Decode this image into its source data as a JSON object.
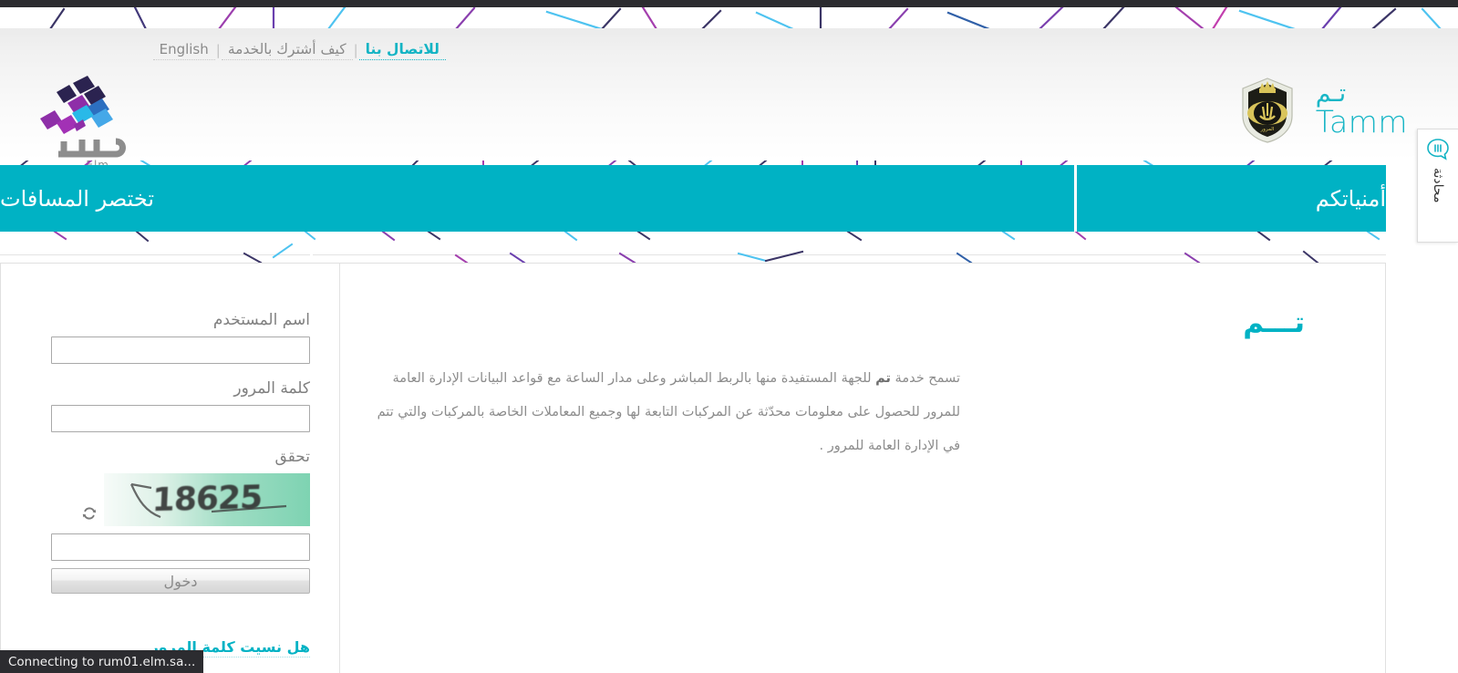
{
  "topnav": {
    "links": [
      {
        "label": "للاتصال بنا",
        "active": true
      },
      {
        "label": "كيف أشترك بالخدمة",
        "active": false
      },
      {
        "label": "English",
        "active": false
      }
    ],
    "separator": "|"
  },
  "logos": {
    "elm": {
      "name": "Elm",
      "latin_label": "Elm"
    },
    "tamm": {
      "arabic": "تـم",
      "latin": "Tamm",
      "emblem": "saudi-traffic-police-emblem"
    }
  },
  "banner": {
    "slogan_right": "تختصر المسافات",
    "slogan_left": "أمنياتكم",
    "background_color": "#00b2c4"
  },
  "chat_tab": {
    "label": "محادثة",
    "icon": "chat-bubble-icon"
  },
  "intro": {
    "title": "تـــم",
    "lead_word": "تم",
    "body_before": "تسمح خدمة ",
    "body_after": " للجهة المستفيدة منها بالربط المباشر وعلى مدار الساعة مع قواعد البيانات الإدارة العامة للمرور للحصول على معلومات محدّثة عن المركبات التابعة لها وجميع المعاملات الخاصة بالمركبات والتي تتم في الإدارة العامة للمرور ."
  },
  "login": {
    "username_label": "اسم المستخدم",
    "username_value": "",
    "username_placeholder": "",
    "password_label": "كلمة المرور",
    "password_value": "",
    "password_placeholder": "",
    "captcha_label": "تحقق",
    "captcha_code": "18625",
    "captcha_value": "",
    "captcha_placeholder": "",
    "refresh_icon": "refresh-icon",
    "submit_label": "دخول",
    "forgot_label": "هل نسيت كلمة المرور"
  },
  "status": {
    "text": "Connecting to rum01.elm.sa..."
  },
  "colors": {
    "teal": "#00b2c4",
    "link_teal": "#14b4c4",
    "muted_text": "#8c8c8c",
    "label_grey": "#808080"
  }
}
